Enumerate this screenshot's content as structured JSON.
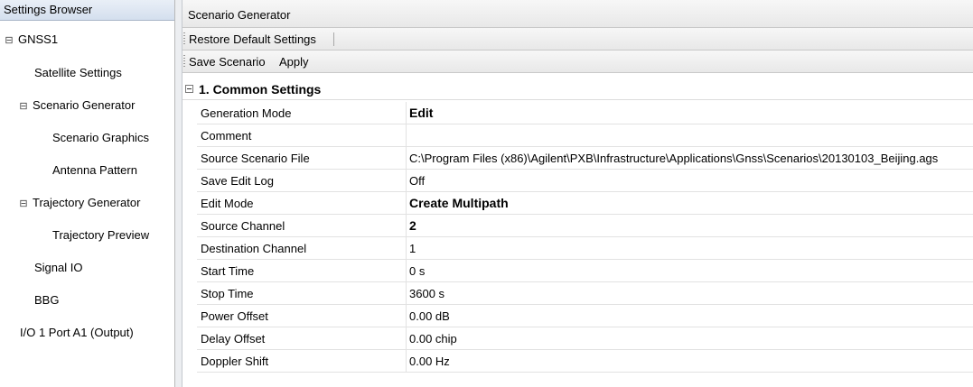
{
  "settings_browser": {
    "title": "Settings Browser",
    "tree": [
      {
        "label": "GNSS1",
        "expander": "⊟",
        "level": 0
      },
      {
        "label": "Satellite Settings",
        "level": 1
      },
      {
        "label": "Scenario Generator",
        "expander": "⊟",
        "level": 1
      },
      {
        "label": "Scenario Graphics",
        "level": 2
      },
      {
        "label": "Antenna Pattern",
        "level": 2
      },
      {
        "label": "Trajectory Generator",
        "expander": "⊟",
        "level": 1
      },
      {
        "label": "Trajectory Preview",
        "level": 2
      },
      {
        "label": "Signal IO",
        "level": 1
      },
      {
        "label": "BBG",
        "level": 1
      },
      {
        "label": "I/O 1 Port A1 (Output)",
        "level": 0
      }
    ]
  },
  "panel": {
    "title": "Scenario Generator",
    "toolbar1": {
      "restore_label": "Restore Default Settings"
    },
    "toolbar2": {
      "save_label": "Save Scenario",
      "apply_label": "Apply"
    },
    "group": {
      "title": "1. Common Settings"
    },
    "properties": [
      {
        "name": "Generation Mode",
        "value": "Edit",
        "bold": true
      },
      {
        "name": "Comment",
        "value": ""
      },
      {
        "name": "Source Scenario File",
        "value": "C:\\Program Files (x86)\\Agilent\\PXB\\Infrastructure\\Applications\\Gnss\\Scenarios\\20130103_Beijing.ags"
      },
      {
        "name": "Save Edit Log",
        "value": "Off"
      },
      {
        "name": "Edit Mode",
        "value": "Create Multipath",
        "bold": true
      },
      {
        "name": "Source Channel",
        "value": "2",
        "bold": true
      },
      {
        "name": "Destination Channel",
        "value": "1"
      },
      {
        "name": "Start Time",
        "value": "0 s"
      },
      {
        "name": "Stop Time",
        "value": "3600 s"
      },
      {
        "name": "Power Offset",
        "value": "0.00 dB"
      },
      {
        "name": "Delay Offset",
        "value": "0.00 chip"
      },
      {
        "name": "Doppler Shift",
        "value": "0.00 Hz"
      }
    ]
  }
}
